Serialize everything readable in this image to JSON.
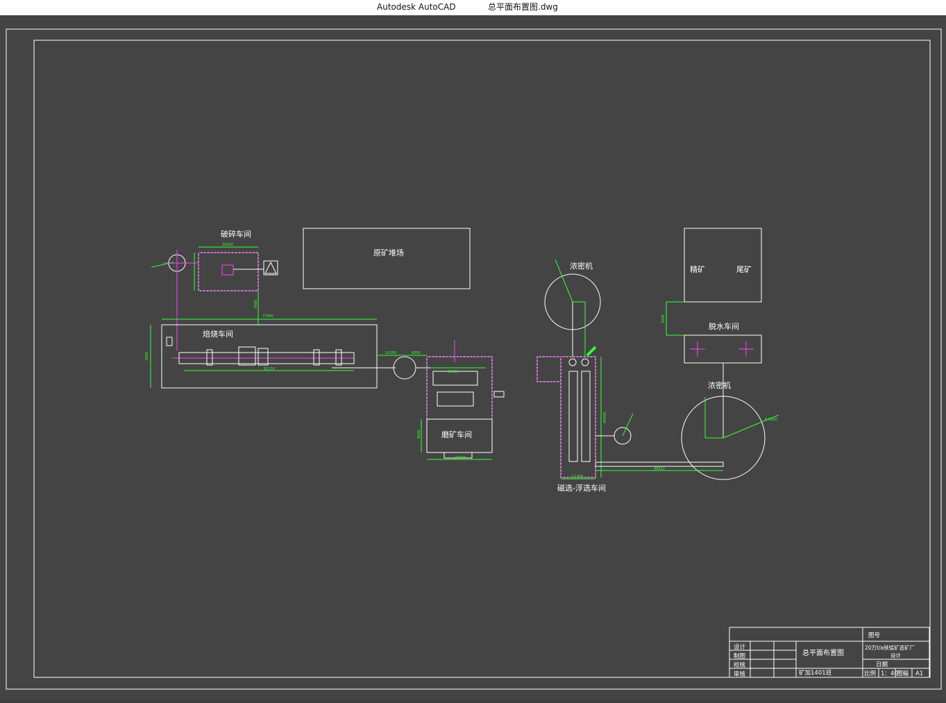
{
  "window": {
    "app_name": "Autodesk AutoCAD",
    "file_name": "总平面布置图.dwg"
  },
  "drawing": {
    "labels": {
      "crushing": "破碎车间",
      "ore_yard": "原矿堆场",
      "roasting": "焙烧车间",
      "grinding": "磨矿车间",
      "magnetic_flotation": "磁选-浮选车间",
      "thickener_top": "浓密机",
      "concentrate": "精矿",
      "tailings": "尾矿",
      "dewatering": "脱水车间",
      "thickener_bottom": "浓密机"
    },
    "dimensions": {
      "d_crush_width": "20610",
      "d_crush_height": "3000",
      "d_crush_to_roast": "7000",
      "d_roast_len": "77000",
      "d_roast_h": "3000",
      "d_roast_inner": "81170",
      "d_link1": "10200",
      "d_link2": "8000",
      "d_grind_w": "24000",
      "d_grind_h": "6000",
      "d_grind_top": "15225",
      "d_mag_w": "12200",
      "d_mag_h": "45000",
      "d_pipe": "46522",
      "d_dewater": "3000",
      "d_thick_r": "R 5000"
    }
  },
  "title_block": {
    "drawing_no_label": "图号",
    "drawing_name": "总平面布置图",
    "project_title": "20万t/a铁锰矿选矿厂",
    "project_subtitle": "设计",
    "date_label": "日期",
    "scale_label": "比例",
    "scale_value": "1：40",
    "sheet_label": "图幅",
    "sheet_value": "A1",
    "class_label": "矿加1401班",
    "rows": [
      "设计",
      "制图",
      "校核",
      "审核"
    ]
  }
}
